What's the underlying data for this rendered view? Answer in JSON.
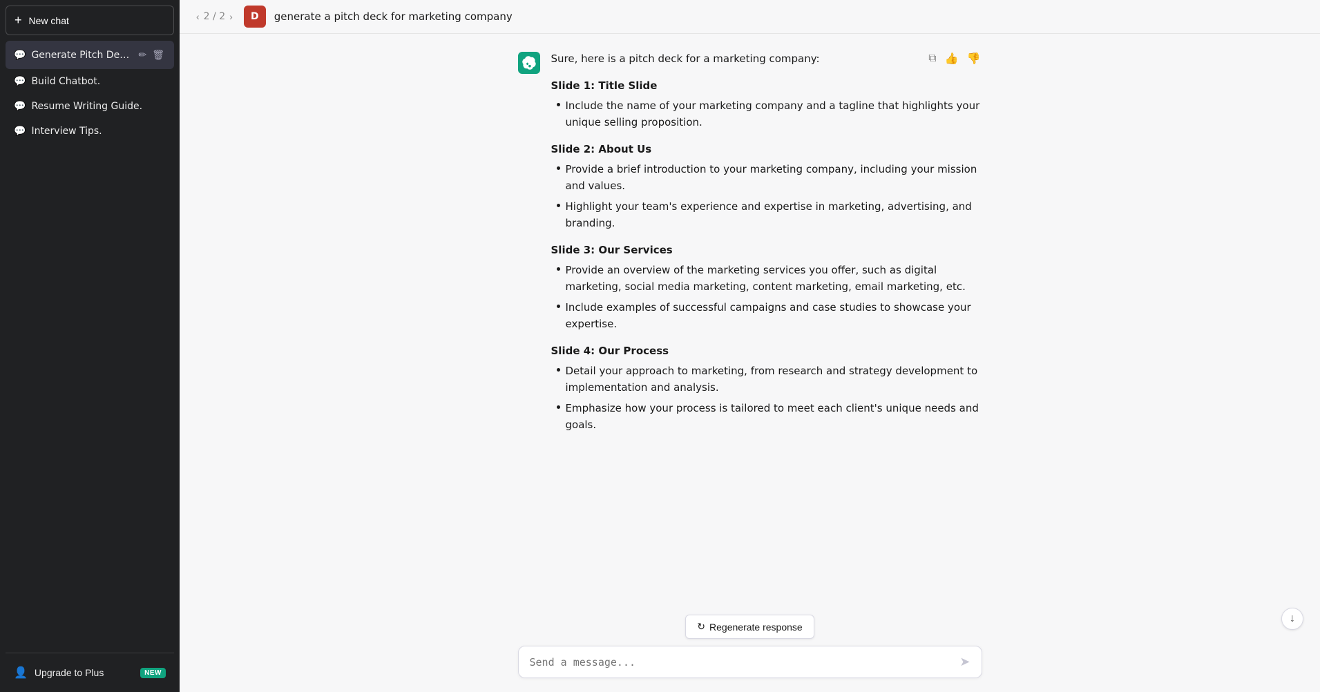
{
  "sidebar": {
    "new_chat_label": "New chat",
    "chats": [
      {
        "id": "generate-pitch-deck",
        "label": "Generate Pitch Deck.",
        "active": true
      },
      {
        "id": "build-chatbot",
        "label": "Build Chatbot.",
        "active": false
      },
      {
        "id": "resume-writing-guide",
        "label": "Resume Writing Guide.",
        "active": false
      },
      {
        "id": "interview-tips",
        "label": "Interview Tips.",
        "active": false
      }
    ],
    "upgrade_label": "Upgrade to Plus",
    "upgrade_badge": "NEW"
  },
  "header": {
    "nav_count": "2 / 2",
    "user_initial": "D",
    "prompt": "generate a pitch deck for marketing company"
  },
  "message": {
    "intro": "Sure, here is a pitch deck for a marketing company:",
    "slides": [
      {
        "heading": "Slide 1: Title Slide",
        "bullets": [
          "Include the name of your marketing company and a tagline that highlights your unique selling proposition."
        ]
      },
      {
        "heading": "Slide 2: About Us",
        "bullets": [
          "Provide a brief introduction to your marketing company, including your mission and values.",
          "Highlight your team's experience and expertise in marketing, advertising, and branding."
        ]
      },
      {
        "heading": "Slide 3: Our Services",
        "bullets": [
          "Provide an overview of the marketing services you offer, such as digital marketing, social media marketing, content marketing, email marketing, etc.",
          "Include examples of successful campaigns and case studies to showcase your expertise."
        ]
      },
      {
        "heading": "Slide 4: Our Process",
        "bullets": [
          "Detail your approach to marketing, from research and strategy development to implementation and analysis.",
          "Emphasize how your process is tailored to meet each client's unique needs and goals."
        ]
      }
    ]
  },
  "input": {
    "placeholder": "Send a message...",
    "send_icon": "➤"
  },
  "regenerate": {
    "label": "Regenerate response"
  },
  "actions": {
    "copy_icon": "⧉",
    "thumbup_icon": "👍",
    "thumbdown_icon": "👎"
  }
}
